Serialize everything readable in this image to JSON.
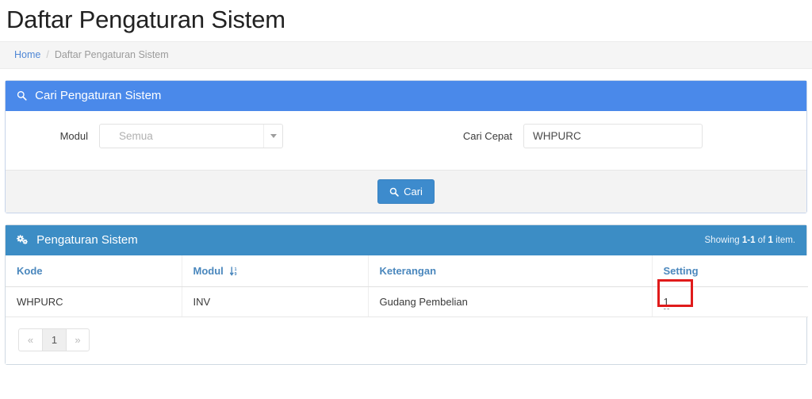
{
  "header": {
    "title": "Daftar Pengaturan Sistem"
  },
  "breadcrumb": {
    "home_label": "Home",
    "separator": "/",
    "current_label": "Daftar Pengaturan Sistem"
  },
  "search_panel": {
    "title": "Cari Pengaturan Sistem",
    "icon": "search-icon",
    "modul": {
      "label": "Modul",
      "value": "Semua",
      "options": [
        "Semua"
      ]
    },
    "cari_cepat": {
      "label": "Cari Cepat",
      "value": "WHPURC",
      "placeholder": ""
    },
    "submit": {
      "label": "Cari",
      "icon": "search-icon"
    }
  },
  "results_panel": {
    "title": "Pengaturan Sistem",
    "icon": "gears-icon",
    "showing": {
      "prefix": "Showing",
      "range": "1-1",
      "middle": "of",
      "total": "1",
      "suffix": "item."
    },
    "columns": [
      {
        "label": "Kode",
        "sortable": false
      },
      {
        "label": "Modul",
        "sortable": true,
        "sort_icon": "sort-numeric-asc-icon"
      },
      {
        "label": "Keterangan",
        "sortable": false
      },
      {
        "label": "Setting",
        "sortable": false
      }
    ],
    "rows": [
      {
        "kode": "WHPURC",
        "modul": "INV",
        "keterangan": "Gudang Pembelian",
        "setting": "1"
      }
    ],
    "annotation": {
      "color": "#e01b1b",
      "target": "setting-value"
    },
    "pagination": {
      "prev": "«",
      "pages": [
        "1"
      ],
      "next": "»",
      "active": "1"
    }
  },
  "colors": {
    "search_panel_header": "#4a89ea",
    "results_panel_header": "#3c8dc5",
    "primary_button": "#3d8bcd",
    "link": "#4f87d6",
    "table_header_text": "#4a87bd",
    "annotation": "#e01b1b"
  }
}
